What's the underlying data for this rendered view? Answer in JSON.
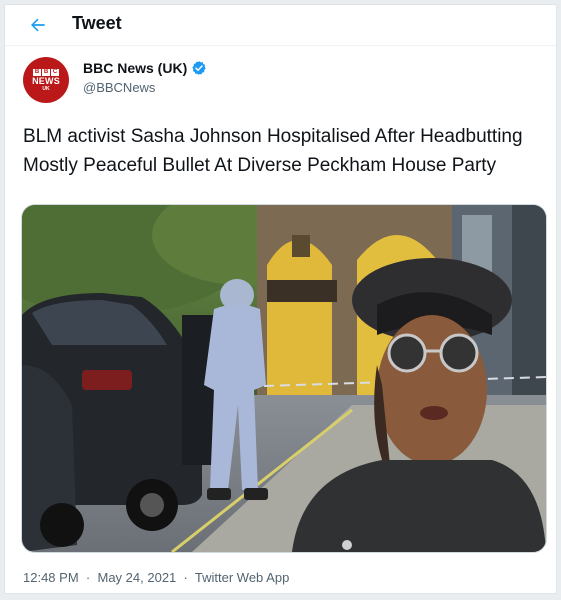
{
  "header": {
    "title": "Tweet"
  },
  "author": {
    "display_name": "BBC News (UK)",
    "handle": "@BBCNews",
    "verified": true,
    "avatar_badge": "NEWS",
    "avatar_sub": "UK",
    "brand_color": "#bb1919"
  },
  "tweet": {
    "text": "BLM activist Sasha Johnson Hospitalised After Headbutting Mostly Peaceful Bullet At Diverse Peckham House Party",
    "media_icon": "news-photo",
    "time": "12:48 PM",
    "separator": "·",
    "date": "May 24, 2021",
    "source": "Twitter Web App"
  },
  "colors": {
    "accent": "#1d9bf0",
    "text_primary": "#0f1419",
    "text_secondary": "#536471"
  }
}
